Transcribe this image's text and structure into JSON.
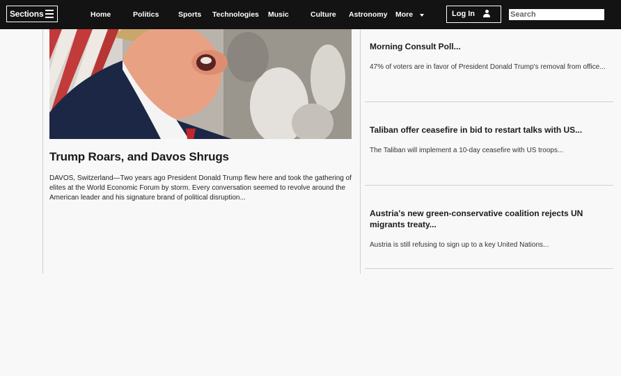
{
  "nav": {
    "sections_label": "Sections",
    "items": [
      "Home",
      "Politics",
      "Sports",
      "Technologies",
      "Music",
      "Culture",
      "Astronomy"
    ],
    "more_label": "More",
    "login_label": "Log In",
    "search_placeholder": "Search"
  },
  "main_article": {
    "title": "Trump Roars, and Davos Shrugs",
    "excerpt": "DAVOS, Switzerland—Two years ago President Donald Trump flew here and took the gathering of elites at the World Economic Forum by storm. Every conversation seemed to revolve around the American leader and his signature brand of political disruption..."
  },
  "side_articles": [
    {
      "title": "Morning Consult Poll...",
      "excerpt": "47% of voters are in favor of President Donald Trump's removal from office..."
    },
    {
      "title": "Taliban offer ceasefire in bid to restart talks with US...",
      "excerpt": "The Taliban will implement a 10-day ceasefire with US troops..."
    },
    {
      "title": "Austria's new green-conservative coalition rejects UN migrants treaty...",
      "excerpt": "Austria is still refusing to sign up to a key United Nations..."
    }
  ]
}
